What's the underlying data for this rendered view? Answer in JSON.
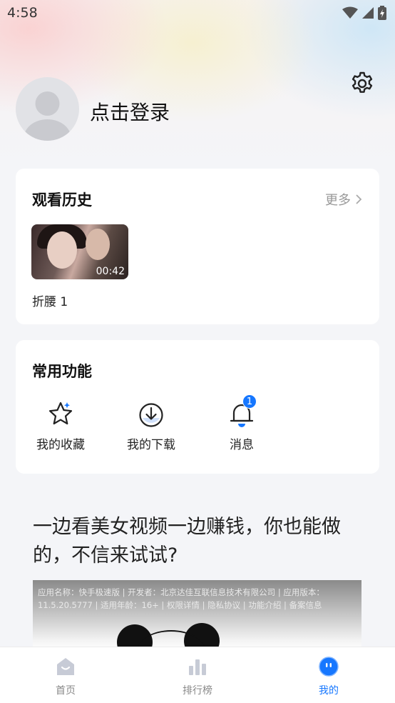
{
  "status_bar": {
    "time": "4:58",
    "icons": [
      "wifi-icon",
      "signal-icon",
      "battery-charging-icon"
    ]
  },
  "profile": {
    "login_text": "点击登录",
    "avatar_icon": "default-avatar-icon",
    "settings_icon": "gear-icon"
  },
  "watch_history": {
    "title": "观看历史",
    "more_label": "更多",
    "items": [
      {
        "title": "折腰 1",
        "duration": "00:42"
      }
    ]
  },
  "common_functions": {
    "title": "常用功能",
    "items": [
      {
        "label": "我的收藏",
        "icon": "star-icon"
      },
      {
        "label": "我的下载",
        "icon": "download-icon"
      },
      {
        "label": "消息",
        "icon": "bell-icon",
        "badge": "1"
      }
    ]
  },
  "ad": {
    "headline": "一边看美女视频一边赚钱，你也能做的，不信来试试?",
    "info_line": "应用名称：快手极速版 | 开发者：北京达佳互联信息技术有限公司 | 应用版本：11.5.20.5777 | 适用年龄：16+ | 权限详情 | 隐私协议 | 功能介绍 | 备案信息"
  },
  "bottom_nav": {
    "items": [
      {
        "label": "首页",
        "icon": "home-icon"
      },
      {
        "label": "排行榜",
        "icon": "ranking-icon"
      },
      {
        "label": "我的",
        "icon": "profile-icon"
      }
    ],
    "active_index": 2
  },
  "colors": {
    "accent": "#1677ff",
    "inactive_nav": "#888888",
    "background": "#f4f5f8"
  }
}
